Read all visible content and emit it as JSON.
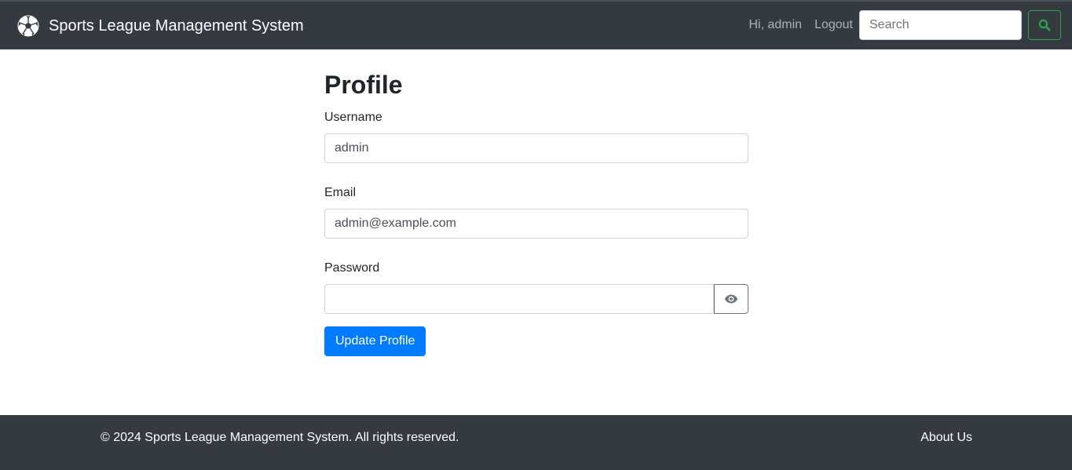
{
  "navbar": {
    "brand": "Sports League Management System",
    "brand_icon": "soccer-ball-icon",
    "greeting": "Hi, admin",
    "logout_label": "Logout",
    "search_placeholder": "Search",
    "search_button_icon": "search-icon",
    "search_button_color": "#28a745",
    "background": "#343a40"
  },
  "main": {
    "title": "Profile",
    "fields": {
      "username": {
        "label": "Username",
        "value": "admin"
      },
      "email": {
        "label": "Email",
        "value": "admin@example.com"
      },
      "password": {
        "label": "Password",
        "value": "",
        "toggle_icon": "eye-icon"
      }
    },
    "submit_label": "Update Profile",
    "accent": "#007bff"
  },
  "footer": {
    "copyright": "© 2024 Sports League Management System. All rights reserved.",
    "about_label": "About Us",
    "background": "#343a40"
  }
}
